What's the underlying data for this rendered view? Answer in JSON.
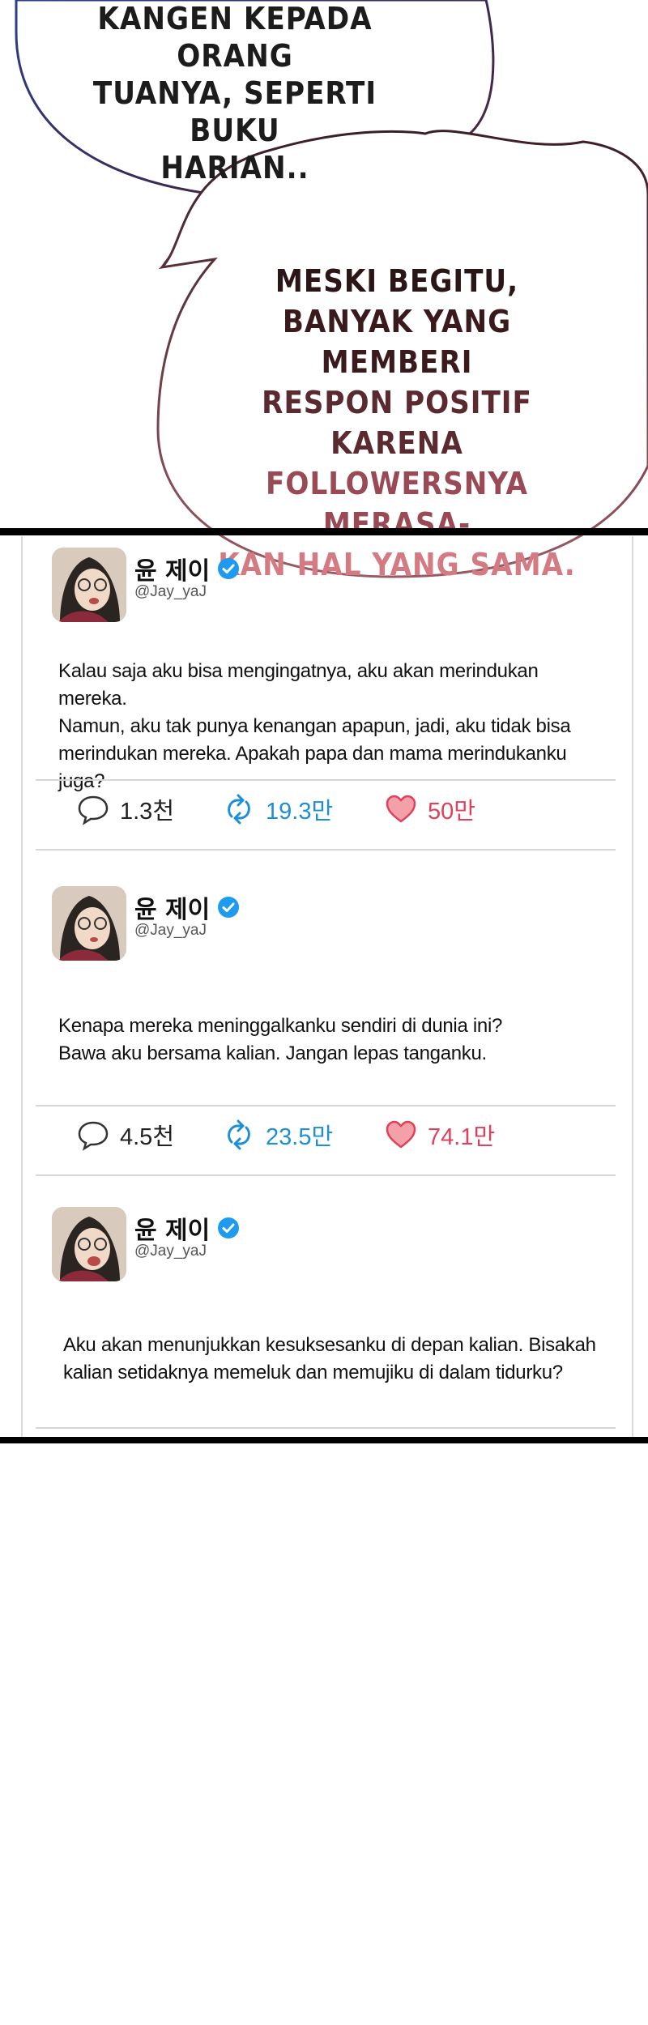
{
  "bubble1": {
    "lines": [
      "KANGEN KEPADA ORANG",
      "TUANYA, SEPERTI BUKU",
      "HARIAN.."
    ]
  },
  "bubble2": {
    "lines": [
      "MESKI BEGITU,",
      "BANYAK YANG MEMBERI",
      "RESPON POSITIF KARENA",
      "FOLLOWERSNYA MERASA-",
      "KAN HAL YANG SAMA."
    ]
  },
  "colors": {
    "verified": "#1d9bf0",
    "retweet": "#1d8fd6",
    "like": "#e0405a",
    "frame": "#000000",
    "divider": "#d6d6d6"
  },
  "tweets": [
    {
      "name": "윤 제이",
      "handle": "@Jay_yaJ",
      "lines": [
        "Kalau saja aku bisa mengingatnya, aku akan merindukan mereka.",
        "Namun, aku tak punya kenangan apapun, jadi, aku tidak bisa",
        "merindukan mereka. Apakah papa dan mama merindukanku juga?"
      ],
      "replies": "1.3천",
      "retweets": "19.3만",
      "likes": "50만"
    },
    {
      "name": "윤 제이",
      "handle": "@Jay_yaJ",
      "lines": [
        "Kenapa mereka meninggalkanku sendiri di dunia ini?",
        "Bawa aku bersama kalian. Jangan lepas tanganku."
      ],
      "replies": "4.5천",
      "retweets": "23.5만",
      "likes": "74.1만"
    },
    {
      "name": "윤 제이",
      "handle": "@Jay_yaJ",
      "lines": [
        "Aku akan menunjukkan kesuksesanku di depan kalian. Bisakah",
        "kalian setidaknya memeluk dan memujiku di dalam tidurku?"
      ]
    }
  ],
  "icons": {
    "reply": "speech-bubble-icon",
    "retweet": "retweet-arrows-icon",
    "like": "heart-icon",
    "verified": "verified-badge-icon"
  }
}
